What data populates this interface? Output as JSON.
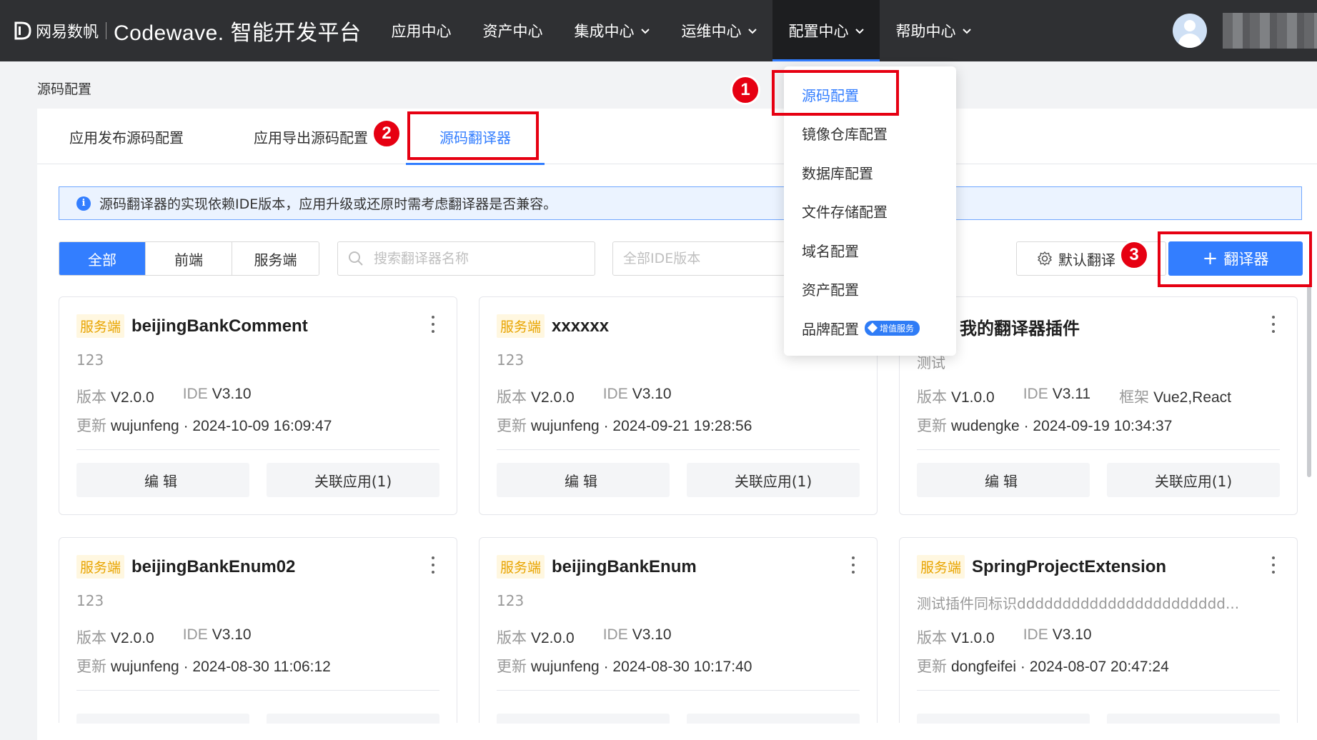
{
  "header": {
    "company": "网易数帆",
    "product": "Codewave. 智能开发平台",
    "nav": [
      {
        "label": "应用中心"
      },
      {
        "label": "资产中心"
      },
      {
        "label": "集成中心"
      },
      {
        "label": "运维中心"
      },
      {
        "label": "配置中心"
      },
      {
        "label": "帮助中心"
      }
    ]
  },
  "breadcrumb": "源码配置",
  "tabs": [
    "应用发布源码配置",
    "应用导出源码配置",
    "源码翻译器"
  ],
  "notice": "源码翻译器的实现依赖IDE版本，应用升级或还原时需考虑翻译器是否兼容。",
  "filters": [
    "全部",
    "前端",
    "服务端"
  ],
  "search": {
    "placeholder": "搜索翻译器名称"
  },
  "ide_select": {
    "placeholder": "全部IDE版本"
  },
  "actions": {
    "default_label": "默认翻译",
    "add_label": "翻译器"
  },
  "dropdown": {
    "items": [
      "源码配置",
      "镜像仓库配置",
      "数据库配置",
      "文件存储配置",
      "域名配置",
      "资产配置",
      "品牌配置"
    ],
    "badge": "增值服务"
  },
  "labels": {
    "version": "版本",
    "ide": "IDE",
    "framework": "框架",
    "updated": "更新",
    "edit": "编辑",
    "linked_apps": "关联应用(1)"
  },
  "cards": [
    {
      "tag": "服务端",
      "title": "beijingBankComment",
      "desc": "123",
      "version": "V2.0.0",
      "ide": "V3.10",
      "framework": "",
      "user": "wujunfeng",
      "time": "· 2024-10-09 16:09:47"
    },
    {
      "tag": "服务端",
      "title": "xxxxxx",
      "desc": "123",
      "version": "V2.0.0",
      "ide": "V3.10",
      "framework": "",
      "user": "wujunfeng",
      "time": "· 2024-09-21 19:28:56"
    },
    {
      "tag": "",
      "title": "我的翻译器插件",
      "desc": "测试",
      "version": "V1.0.0",
      "ide": "V3.11",
      "framework": "Vue2,React",
      "user": "wudengke",
      "time": "· 2024-09-19 10:34:37"
    },
    {
      "tag": "服务端",
      "title": "beijingBankEnum02",
      "desc": "123",
      "version": "V2.0.0",
      "ide": "V3.10",
      "framework": "",
      "user": "wujunfeng",
      "time": "· 2024-08-30 11:06:12"
    },
    {
      "tag": "服务端",
      "title": "beijingBankEnum",
      "desc": "123",
      "version": "V2.0.0",
      "ide": "V3.10",
      "framework": "",
      "user": "wujunfeng",
      "time": "· 2024-08-30 10:17:40"
    },
    {
      "tag": "服务端",
      "title": "SpringProjectExtension",
      "desc": "测试插件同标识ddddddddddddddddddddddd...",
      "version": "V1.0.0",
      "ide": "V3.10",
      "framework": "",
      "user": "dongfeifei",
      "time": "· 2024-08-07 20:47:24"
    }
  ],
  "steps": [
    "1",
    "2",
    "3"
  ],
  "colors": {
    "accent": "#337eff",
    "topbar": "#2f3033",
    "highlight": "#e60012",
    "tag_text": "#e8a400"
  }
}
